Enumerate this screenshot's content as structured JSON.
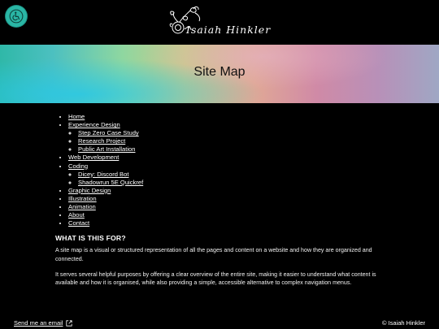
{
  "header": {
    "accessibility_icon": "wheelchair-icon",
    "logo_text": "Isaiah Hinkler",
    "logo_icon": "flower-sketch-icon"
  },
  "hero": {
    "title": "Site Map"
  },
  "nav": {
    "items": [
      {
        "label": "Home",
        "children": []
      },
      {
        "label": "Experience Design",
        "children": [
          {
            "label": "Step Zero Case Study"
          },
          {
            "label": "Research Project"
          },
          {
            "label": "Public Art Installation"
          }
        ]
      },
      {
        "label": "Web Development",
        "children": []
      },
      {
        "label": "Coding",
        "children": [
          {
            "label": "Dicey: Discord Bot"
          },
          {
            "label": "Shadowrun 5E Quickref"
          }
        ]
      },
      {
        "label": "Graphic Design",
        "children": []
      },
      {
        "label": "Illustration",
        "children": []
      },
      {
        "label": "Animation",
        "children": []
      },
      {
        "label": "About",
        "children": []
      },
      {
        "label": "Contact",
        "children": []
      }
    ]
  },
  "content": {
    "heading": "WHAT IS THIS FOR?",
    "paragraphs": [
      "A site map is a visual or structured representation of all the pages and content on a website and how they are organized and connected.",
      "It serves several helpful purposes by offering a clear overview of the entire site, making it easier to understand what content is available and how it is organised, while also providing a simple, accessible alternative to complex navigation menus."
    ]
  },
  "footer": {
    "email_link": "Send me an email",
    "email_icon": "external-link-icon",
    "copyright": "© Isaiah Hinkler"
  },
  "colors": {
    "accessibility_bg": "#2ab6a5",
    "background": "#000000"
  }
}
